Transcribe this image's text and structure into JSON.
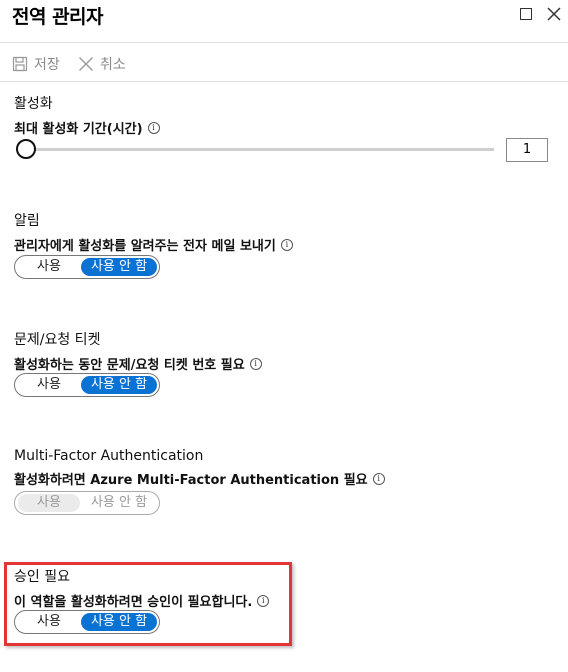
{
  "window": {
    "title": "전역 관리자",
    "maximize_icon": "maximize-icon",
    "close_icon": "close-icon"
  },
  "toolbar": {
    "save_label": "저장",
    "cancel_label": "취소"
  },
  "activation": {
    "title": "활성화",
    "label": "최대 활성화 기간(시간)",
    "value": "1"
  },
  "notification": {
    "title": "알림",
    "label": "관리자에게 활성화를 알려주는 전자 메일 보내기",
    "toggle": {
      "on_label": "사용",
      "off_label": "사용 안 함",
      "selected": "사용 안 함"
    }
  },
  "ticket": {
    "title": "문제/요청 티켓",
    "label": "활성화하는 동안 문제/요청 티켓 번호 필요",
    "toggle": {
      "on_label": "사용",
      "off_label": "사용 안 함",
      "selected": "사용 안 함"
    }
  },
  "mfa": {
    "title": "Multi-Factor Authentication",
    "label": "활성화하려면 Azure Multi-Factor Authentication 필요",
    "toggle": {
      "on_label": "사용",
      "off_label": "사용 안 함",
      "disabled": true
    }
  },
  "approval": {
    "title": "승인 필요",
    "label": "이 역할을 활성화하려면 승인이 필요합니다.",
    "toggle": {
      "on_label": "사용",
      "off_label": "사용 안 함",
      "selected": "사용 안 함"
    }
  },
  "colors": {
    "accent": "#0a72d3",
    "highlight": "#e23535"
  }
}
